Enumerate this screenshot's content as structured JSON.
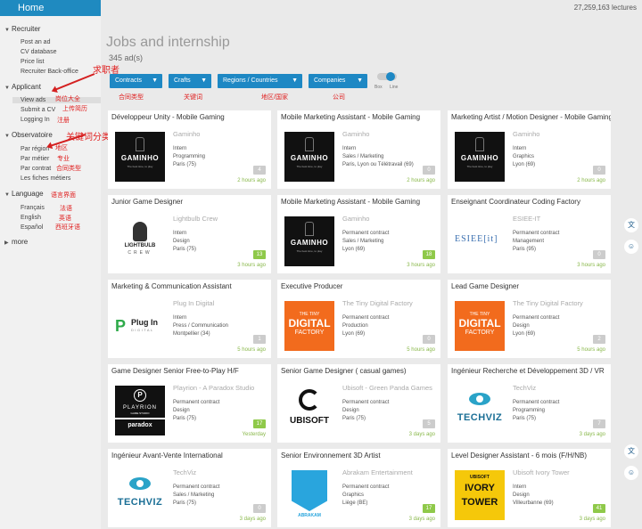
{
  "sidebar": {
    "home": "Home",
    "sections": [
      {
        "label": "Recruiter",
        "items": [
          "Post an ad",
          "CV database",
          "Price list",
          "Recruiter Back-office"
        ]
      },
      {
        "label": "Applicant",
        "items": [
          "View ads",
          "Submit a CV",
          "Logging In"
        ]
      },
      {
        "label": "Observatoire",
        "items": [
          "Par région",
          "Par métier",
          "Par contrat",
          "Les fiches métiers"
        ]
      },
      {
        "label": "Language",
        "items": [
          "Français",
          "English",
          "Español"
        ]
      },
      {
        "label": "more",
        "items": []
      }
    ]
  },
  "annotations": {
    "recruiter": "求职者",
    "view_ads": "岗位大全",
    "submit_cv": "上传简历",
    "logging_in": "注册",
    "observatoire": "关键词分类",
    "par_region": "地区",
    "par_metier": "专业",
    "par_contrat": "合同类型",
    "language": "语言界面",
    "francais": "法语",
    "english": "英语",
    "espanol": "西班牙语",
    "contracts": "合同类型",
    "crafts": "关键词",
    "regions": "地区/国家",
    "companies": "公司"
  },
  "header": {
    "counter": "27,259,163 lectures",
    "title": "Jobs and internship",
    "ad_count": "345 ad(s)"
  },
  "filters": {
    "contracts": "Contracts",
    "crafts": "Crafts",
    "regions": "Regions / Countries",
    "companies": "Companies",
    "toggle_box": "Box",
    "toggle_line": "Line"
  },
  "cards": [
    {
      "title": "Développeur Unity - Mobile Gaming",
      "company": "Gaminho",
      "logo": "gaminho",
      "contract": "Intern",
      "craft": "Programming",
      "location": "Paris (75)",
      "count": "4",
      "green": false,
      "ago": "2 hours ago"
    },
    {
      "title": "Mobile Marketing Assistant - Mobile Gaming",
      "company": "Gaminho",
      "logo": "gaminho",
      "contract": "Intern",
      "craft": "Sales / Marketing",
      "location": "Paris, Lyon ou Télétravail (69)",
      "count": "0",
      "green": false,
      "ago": "2 hours ago"
    },
    {
      "title": "Marketing Artist / Motion Designer - Mobile Gaming",
      "company": "Gaminho",
      "logo": "gaminho",
      "contract": "Intern",
      "craft": "Graphics",
      "location": "Lyon (69)",
      "count": "0",
      "green": false,
      "ago": "2 hours ago"
    },
    {
      "title": "Junior Game Designer",
      "company": "Lightbulb Crew",
      "logo": "lightbulb",
      "contract": "Intern",
      "craft": "Design",
      "location": "Paris (75)",
      "count": "13",
      "green": true,
      "ago": "3 hours ago"
    },
    {
      "title": "Mobile Marketing Assistant - Mobile Gaming",
      "company": "Gaminho",
      "logo": "gaminho",
      "contract": "Permanent contract",
      "craft": "Sales / Marketing",
      "location": "Lyon (69)",
      "count": "18",
      "green": true,
      "ago": "3 hours ago"
    },
    {
      "title": "Enseignant Coordinateur Coding Factory",
      "company": "ESIEE-IT",
      "logo": "esiee",
      "contract": "Permanent contract",
      "craft": "Management",
      "location": "Paris (95)",
      "count": "0",
      "green": false,
      "ago": "3 hours ago"
    },
    {
      "title": "Marketing & Communication Assistant",
      "company": "Plug In Digital",
      "logo": "plugin",
      "contract": "Intern",
      "craft": "Press / Communication",
      "location": "Montpellier (34)",
      "count": "1",
      "green": false,
      "ago": "5 hours ago"
    },
    {
      "title": "Executive Producer",
      "company": "The Tiny Digital Factory",
      "logo": "tiny",
      "contract": "Permanent contract",
      "craft": "Production",
      "location": "Lyon (69)",
      "count": "0",
      "green": false,
      "ago": "5 hours ago"
    },
    {
      "title": "Lead Game Designer",
      "company": "The Tiny Digital Factory",
      "logo": "tiny",
      "contract": "Permanent contract",
      "craft": "Design",
      "location": "Lyon (69)",
      "count": "2",
      "green": false,
      "ago": "5 hours ago"
    },
    {
      "title": "Game Designer Senior Free-to-Play H/F",
      "company": "Playrion - A Paradox Studio",
      "logo": "playrion",
      "contract": "Permanent contract",
      "craft": "Design",
      "location": "Paris (75)",
      "count": "17",
      "green": true,
      "ago": "Yesterday"
    },
    {
      "title": "Senior Game Designer ( casual games)",
      "company": "Ubisoft - Green Panda Games",
      "logo": "ubisoft",
      "contract": "Permanent contract",
      "craft": "Design",
      "location": "Paris (75)",
      "count": "5",
      "green": false,
      "ago": "3 days ago"
    },
    {
      "title": "Ingénieur Recherche et Développement 3D / VR",
      "company": "TechViz",
      "logo": "techviz",
      "contract": "Permanent contract",
      "craft": "Programming",
      "location": "Paris (75)",
      "count": "7",
      "green": false,
      "ago": "3 days ago"
    },
    {
      "title": "Ingénieur Avant-Vente International",
      "company": "TechViz",
      "logo": "techviz",
      "contract": "Permanent contract",
      "craft": "Sales / Marketing",
      "location": "Paris (75)",
      "count": "0",
      "green": false,
      "ago": "3 days ago"
    },
    {
      "title": "Senior Environnement 3D Artist",
      "company": "Abrakam Entertainment",
      "logo": "abrakam",
      "contract": "Permanent contract",
      "craft": "Graphics",
      "location": "Liège (BE)",
      "count": "17",
      "green": true,
      "ago": "3 days ago"
    },
    {
      "title": "Level Designer Assistant - 6 mois (F/H/NB)",
      "company": "Ubisoft Ivory Tower",
      "logo": "ivory",
      "contract": "Intern",
      "craft": "Design",
      "location": "Villeurbanne (69)",
      "count": "41",
      "green": true,
      "ago": "3 days ago"
    }
  ],
  "logos": {
    "gaminho": {
      "name": "GAMINHO",
      "slogan": "The best time, to play"
    },
    "lightbulb": {
      "line1": "LIGHTBULB",
      "line2": "CREW"
    },
    "esiee": {
      "name": "ESIEE[it]"
    },
    "plugin": {
      "mark": "P",
      "line1": "Plug In",
      "line2": "DIGITAL"
    },
    "tiny": {
      "line1": "THE TINY",
      "line2": "DIGITAL",
      "line3": "FACTORY"
    },
    "playrion": {
      "mark": "P",
      "line1": "PLAYRION",
      "line1s": "GAME STUDIO",
      "line2": "paradox"
    },
    "ubisoft": {
      "name": "UBISOFT"
    },
    "techviz": {
      "name": "TECHVIZ"
    },
    "abrakam": {
      "name": "ABRAKAM"
    },
    "ivory": {
      "line0": "UBISOFT",
      "line1": "IVORY",
      "line2": "TOWER"
    }
  },
  "floating": [
    "translate-icon",
    "chat-icon",
    "translate-icon",
    "chat-icon"
  ]
}
